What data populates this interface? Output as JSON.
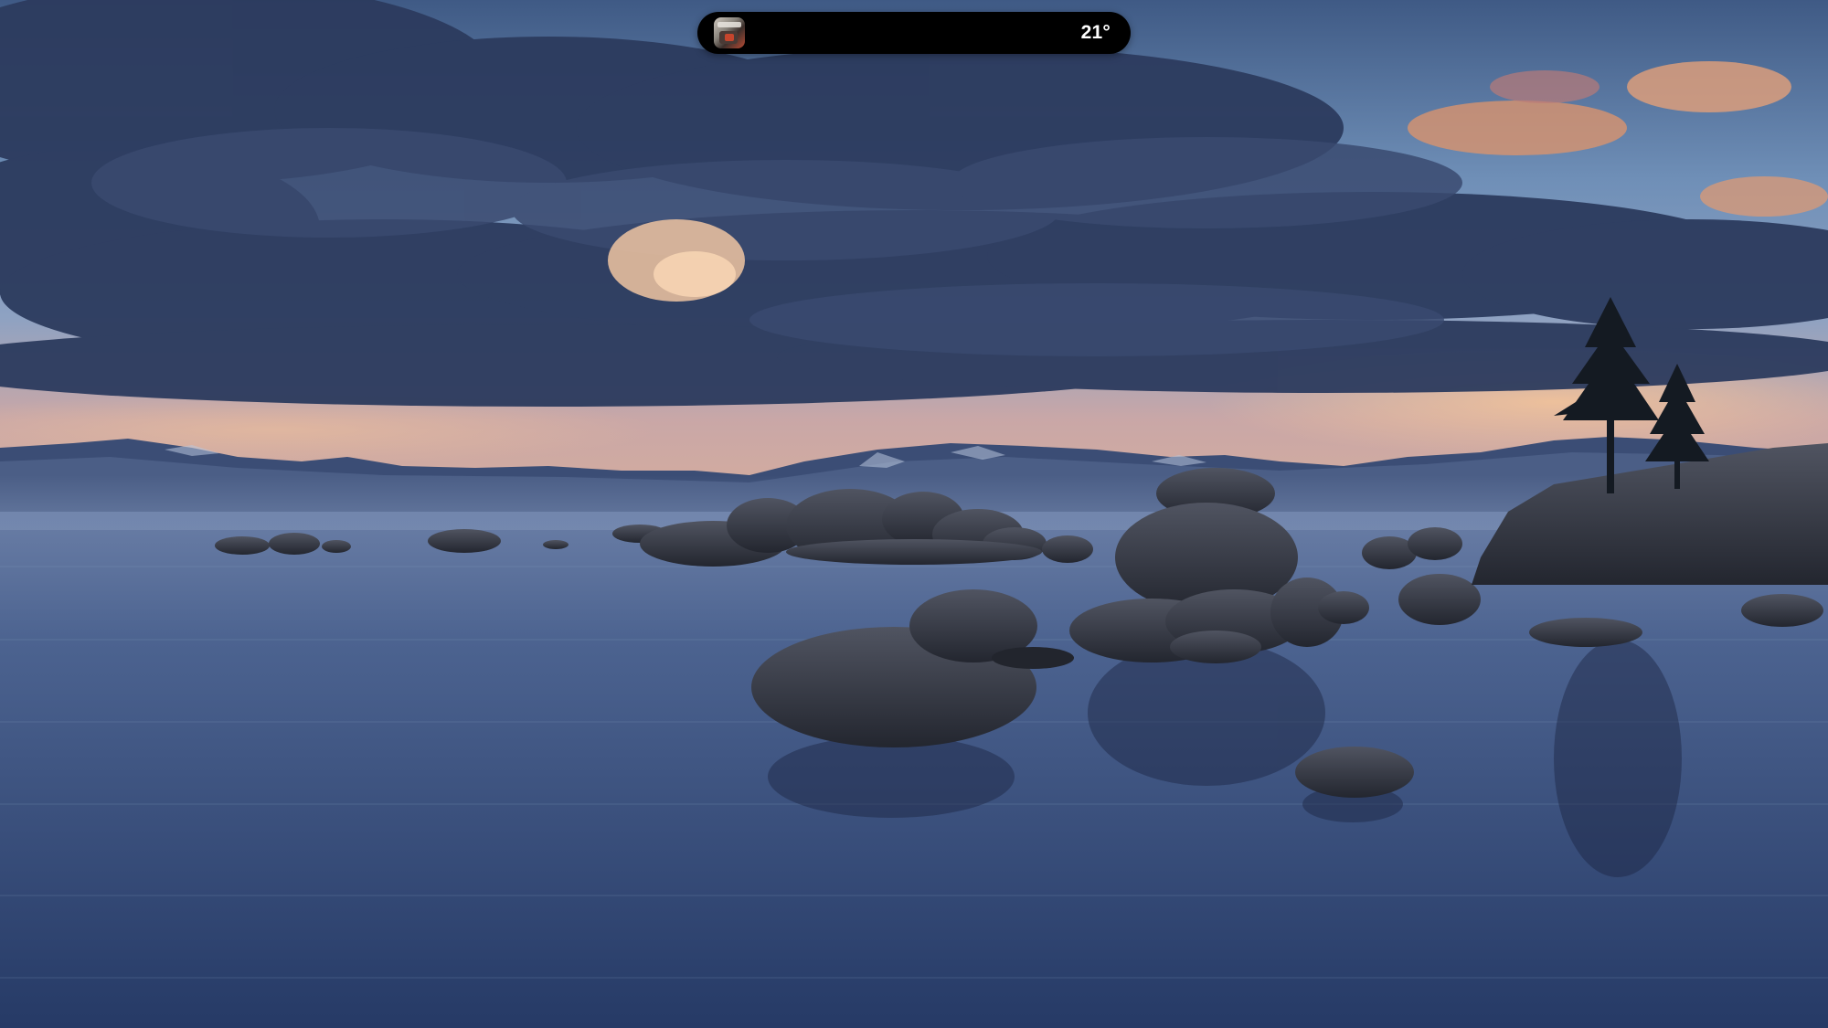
{
  "dynamic_island": {
    "album_art_icon": "album-art-thumbnail",
    "temperature": "21°"
  },
  "colors": {
    "island_background": "#000000",
    "island_text": "#ffffff"
  }
}
